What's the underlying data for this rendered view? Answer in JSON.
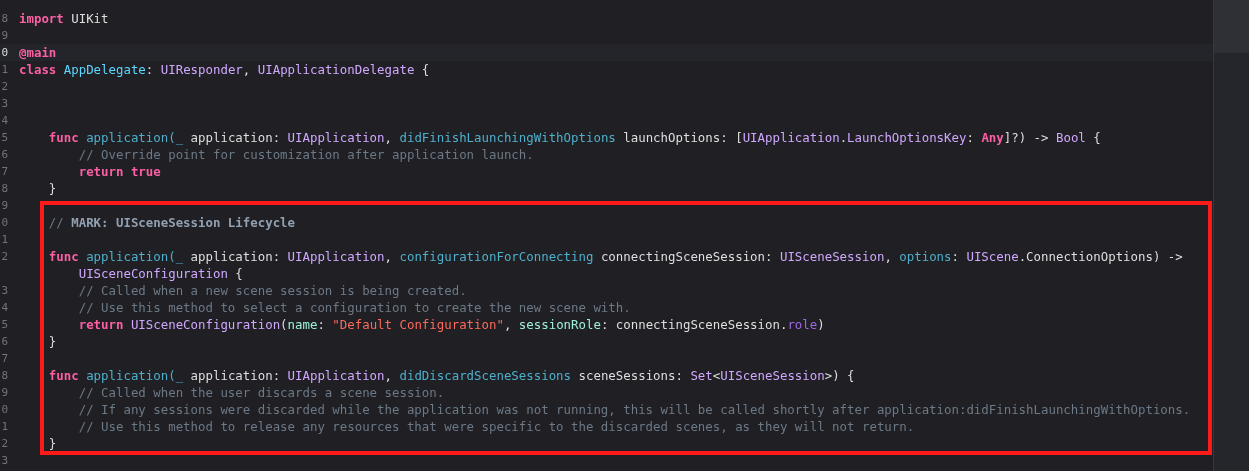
{
  "editor": {
    "sections": [
      {
        "boxed": false,
        "lines": [
          {
            "number": "8",
            "current": false,
            "tokens": [
              {
                "kind": "keyword",
                "text": "import"
              },
              {
                "kind": "plain",
                "text": " UIKit"
              }
            ]
          },
          {
            "number": "9",
            "current": false
          },
          {
            "number": "0",
            "current": true,
            "tokens": [
              {
                "kind": "keyword",
                "text": "@main"
              }
            ]
          },
          {
            "number": "1",
            "current": false,
            "tokens": [
              {
                "kind": "keyword",
                "text": "class"
              },
              {
                "kind": "classname",
                "text": " AppDelegate"
              },
              {
                "kind": "plain",
                "text": ": "
              },
              {
                "kind": "type",
                "text": "UIResponder"
              },
              {
                "kind": "plain",
                "text": ", "
              },
              {
                "kind": "type",
                "text": "UIApplicationDelegate"
              },
              {
                "kind": "plain",
                "text": " {"
              }
            ]
          },
          {
            "number": "2",
            "current": false
          },
          {
            "number": "3",
            "current": false
          },
          {
            "number": "4",
            "current": false
          },
          {
            "number": "5",
            "current": false,
            "tokens": [
              {
                "kind": "keyword",
                "text": "    func"
              },
              {
                "kind": "function",
                "text": " application(_"
              },
              {
                "kind": "plain",
                "text": " application: "
              },
              {
                "kind": "type",
                "text": "UIApplication"
              },
              {
                "kind": "plain",
                "text": ", "
              },
              {
                "kind": "function",
                "text": "didFinishLaunchingWithOptions"
              },
              {
                "kind": "plain",
                "text": " launchOptions: ["
              },
              {
                "kind": "type",
                "text": "UIApplication"
              },
              {
                "kind": "plain",
                "text": "."
              },
              {
                "kind": "type",
                "text": "LaunchOptionsKey"
              },
              {
                "kind": "plain",
                "text": ": "
              },
              {
                "kind": "keyword",
                "text": "Any"
              },
              {
                "kind": "plain",
                "text": "]?) -> "
              },
              {
                "kind": "type",
                "text": "Bool"
              },
              {
                "kind": "plain",
                "text": " {"
              }
            ]
          },
          {
            "number": "6",
            "current": false,
            "tokens": [
              {
                "kind": "comment",
                "text": "        // Override point for customization after application launch."
              }
            ]
          },
          {
            "number": "7",
            "current": false,
            "tokens": [
              {
                "kind": "keyword",
                "text": "        return"
              },
              {
                "kind": "keyword",
                "text": " true"
              }
            ]
          },
          {
            "number": "8",
            "current": false,
            "tokens": [
              {
                "kind": "plain",
                "text": "    }"
              }
            ]
          },
          {
            "number": "9",
            "current": false
          }
        ]
      },
      {
        "boxed": true,
        "lines": [
          {
            "number": "0",
            "current": false,
            "tokens": [
              {
                "kind": "comment",
                "text": "    // "
              },
              {
                "kind": "mark",
                "text": "MARK: UISceneSession Lifecycle"
              }
            ]
          },
          {
            "number": "1",
            "current": false
          },
          {
            "number": "2",
            "current": false,
            "tokens": [
              {
                "kind": "keyword",
                "text": "    func"
              },
              {
                "kind": "function",
                "text": " application(_"
              },
              {
                "kind": "plain",
                "text": " application: "
              },
              {
                "kind": "type",
                "text": "UIApplication"
              },
              {
                "kind": "plain",
                "text": ", "
              },
              {
                "kind": "function",
                "text": "configurationForConnecting"
              },
              {
                "kind": "plain",
                "text": " connectingSceneSession: "
              },
              {
                "kind": "type",
                "text": "UISceneSession"
              },
              {
                "kind": "plain",
                "text": ", "
              },
              {
                "kind": "function",
                "text": "options"
              },
              {
                "kind": "plain",
                "text": ": "
              },
              {
                "kind": "type",
                "text": "UIScene"
              },
              {
                "kind": "plain",
                "text": ".ConnectionOptions) ->"
              }
            ],
            "continuation": [
              {
                "kind": "type",
                "text": "        UISceneConfiguration"
              },
              {
                "kind": "plain",
                "text": " {"
              }
            ]
          },
          {
            "number": "3",
            "current": false,
            "tokens": [
              {
                "kind": "comment",
                "text": "        // Called when a new scene session is being created."
              }
            ]
          },
          {
            "number": "4",
            "current": false,
            "tokens": [
              {
                "kind": "comment",
                "text": "        // Use this method to select a configuration to create the new scene with."
              }
            ]
          },
          {
            "number": "5",
            "current": false,
            "tokens": [
              {
                "kind": "keyword",
                "text": "        return"
              },
              {
                "kind": "type",
                "text": " UISceneConfiguration"
              },
              {
                "kind": "plain",
                "text": "("
              },
              {
                "kind": "label",
                "text": "name"
              },
              {
                "kind": "plain",
                "text": ": "
              },
              {
                "kind": "string",
                "text": "\"Default Configuration\""
              },
              {
                "kind": "plain",
                "text": ", "
              },
              {
                "kind": "label",
                "text": "sessionRole"
              },
              {
                "kind": "plain",
                "text": ": connectingSceneSession."
              },
              {
                "kind": "property",
                "text": "role"
              },
              {
                "kind": "plain",
                "text": ")"
              }
            ]
          },
          {
            "number": "6",
            "current": false,
            "tokens": [
              {
                "kind": "plain",
                "text": "    }"
              }
            ]
          },
          {
            "number": "7",
            "current": false
          },
          {
            "number": "8",
            "current": false,
            "tokens": [
              {
                "kind": "keyword",
                "text": "    func"
              },
              {
                "kind": "function",
                "text": " application(_"
              },
              {
                "kind": "plain",
                "text": " application: "
              },
              {
                "kind": "type",
                "text": "UIApplication"
              },
              {
                "kind": "plain",
                "text": ", "
              },
              {
                "kind": "function",
                "text": "didDiscardSceneSessions"
              },
              {
                "kind": "plain",
                "text": " sceneSessions: "
              },
              {
                "kind": "type",
                "text": "Set"
              },
              {
                "kind": "plain",
                "text": "<"
              },
              {
                "kind": "type",
                "text": "UISceneSession"
              },
              {
                "kind": "plain",
                "text": ">) {"
              }
            ]
          },
          {
            "number": "9",
            "current": false,
            "tokens": [
              {
                "kind": "comment",
                "text": "        // Called when the user discards a scene session."
              }
            ]
          },
          {
            "number": "0",
            "current": false,
            "tokens": [
              {
                "kind": "comment",
                "text": "        // If any sessions were discarded while the application was not running, this will be called shortly after application:didFinishLaunchingWithOptions."
              }
            ]
          },
          {
            "number": "1",
            "current": false,
            "tokens": [
              {
                "kind": "comment",
                "text": "        // Use this method to release any resources that were specific to the discarded scenes, as they will not return."
              }
            ]
          },
          {
            "number": "2",
            "current": false,
            "tokens": [
              {
                "kind": "plain",
                "text": "    }"
              }
            ]
          }
        ]
      },
      {
        "boxed": false,
        "lines": [
          {
            "number": "3",
            "current": false
          }
        ]
      }
    ]
  }
}
